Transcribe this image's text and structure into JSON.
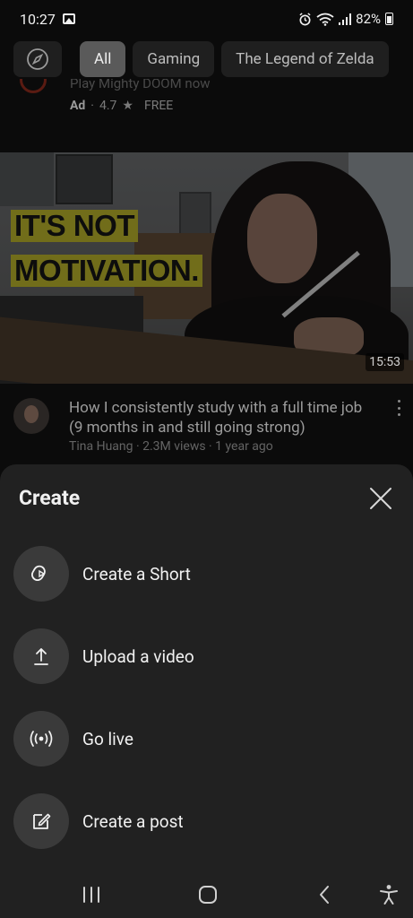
{
  "status_bar": {
    "time": "10:27",
    "battery": "82%"
  },
  "chips": [
    {
      "label": "All",
      "active": true
    },
    {
      "label": "Gaming",
      "active": false
    },
    {
      "label": "The Legend of Zelda",
      "active": false
    }
  ],
  "ad": {
    "title": "Play Mighty DOOM now",
    "label": "Ad",
    "rating": "4.7",
    "price": "FREE"
  },
  "video": {
    "thumbnail_text_line1": "IT'S NOT",
    "thumbnail_text_line2": "MOTIVATION.",
    "duration": "15:53",
    "title": "How I consistently study with a full time job (9 months in and still going strong)",
    "meta": "Tina Huang · 2.3M views · 1 year ago"
  },
  "sheet": {
    "title": "Create",
    "options": [
      {
        "label": "Create a Short",
        "icon": "shorts-icon"
      },
      {
        "label": "Upload a video",
        "icon": "upload-icon"
      },
      {
        "label": "Go live",
        "icon": "live-icon"
      },
      {
        "label": "Create a post",
        "icon": "edit-icon"
      }
    ]
  },
  "colors": {
    "sheet_bg": "#212121",
    "icon_circle": "#3a3a3a",
    "chip_active": "#5a5a5a"
  }
}
